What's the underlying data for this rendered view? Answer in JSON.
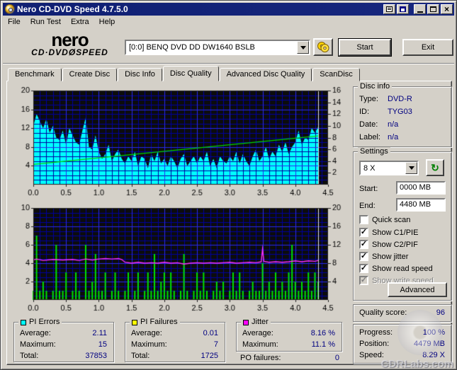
{
  "window": {
    "title": "Nero CD-DVD Speed 4.7.5.0"
  },
  "menu": {
    "items": [
      "File",
      "Run Test",
      "Extra",
      "Help"
    ]
  },
  "toolbar": {
    "logo_line1": "nero",
    "logo_line2": "CD·DVDØSPEED",
    "drive": "[0:0]   BENQ DVD DD DW1640 BSLB",
    "start_label": "Start",
    "exit_label": "Exit"
  },
  "tabs": {
    "items": [
      "Benchmark",
      "Create Disc",
      "Disc Info",
      "Disc Quality",
      "Advanced Disc Quality",
      "ScanDisc"
    ],
    "active": "Disc Quality"
  },
  "disc_info": {
    "title": "Disc info",
    "rows": [
      {
        "label": "Type:",
        "value": "DVD-R"
      },
      {
        "label": "ID:",
        "value": "TYG03"
      },
      {
        "label": "Date:",
        "value": "n/a"
      },
      {
        "label": "Label:",
        "value": "n/a"
      }
    ]
  },
  "settings": {
    "title": "Settings",
    "speed_value": "8 X",
    "start_label": "Start:",
    "start_value": "0000 MB",
    "end_label": "End:",
    "end_value": "4480 MB",
    "checkboxes": [
      {
        "label": "Quick scan",
        "checked": false,
        "disabled": false
      },
      {
        "label": "Show C1/PIE",
        "checked": true,
        "disabled": false
      },
      {
        "label": "Show C2/PIF",
        "checked": true,
        "disabled": false
      },
      {
        "label": "Show jitter",
        "checked": true,
        "disabled": false
      },
      {
        "label": "Show read speed",
        "checked": true,
        "disabled": false
      },
      {
        "label": "Show write speed",
        "checked": true,
        "disabled": true
      }
    ],
    "advanced_label": "Advanced"
  },
  "quality": {
    "label": "Quality score:",
    "value": "96"
  },
  "progress": {
    "rows": [
      {
        "label": "Progress:",
        "value": "100 %"
      },
      {
        "label": "Position:",
        "value": "4479 MB"
      },
      {
        "label": "Speed:",
        "value": "8.29 X"
      }
    ]
  },
  "stats": {
    "pi_errors": {
      "title": "PI Errors",
      "color": "#00ffff",
      "rows": [
        {
          "label": "Average:",
          "value": "2.11"
        },
        {
          "label": "Maximum:",
          "value": "15"
        },
        {
          "label": "Total:",
          "value": "37853"
        }
      ]
    },
    "pi_failures": {
      "title": "PI Failures",
      "color": "#ffff00",
      "rows": [
        {
          "label": "Average:",
          "value": "0.01"
        },
        {
          "label": "Maximum:",
          "value": "7"
        },
        {
          "label": "Total:",
          "value": "1725"
        }
      ]
    },
    "jitter": {
      "title": "Jitter",
      "color": "#ff00ff",
      "rows": [
        {
          "label": "Average:",
          "value": "8.16 %"
        },
        {
          "label": "Maximum:",
          "value": "11.1 %"
        }
      ]
    },
    "po_failures": {
      "label": "PO failures:",
      "value": "0"
    }
  },
  "watermark": {
    "text": "CDRLabs.com"
  },
  "chart_data": [
    {
      "type": "area",
      "title": "PI Errors scan with read speed overlay",
      "x_axis": {
        "range": [
          0,
          4.5
        ],
        "tick": 0.5,
        "minor": 0.1,
        "labels": [
          "0.0",
          "0.5",
          "1.0",
          "1.5",
          "2.0",
          "2.5",
          "3.0",
          "3.5",
          "4.0",
          "4.5"
        ]
      },
      "left_axis": {
        "range": [
          0,
          20
        ],
        "ticks": [
          4,
          8,
          12,
          16,
          20
        ],
        "minor": 1
      },
      "right_axis": {
        "range": [
          0,
          16
        ],
        "ticks": [
          2,
          4,
          6,
          8,
          10,
          12,
          14,
          16
        ]
      },
      "plot_bg": "#0c0c0c",
      "grid_minor": "#0000a0",
      "grid_major": "#2828f0",
      "end_marker_x": 4.35,
      "end_marker_color": "#e0e0e0",
      "series": [
        {
          "name": "PI Errors",
          "style": "area",
          "axis": "left",
          "color": "#00ffff",
          "x_step": 0.05,
          "values": [
            12.5,
            15,
            13.5,
            12,
            14,
            11,
            12.5,
            10,
            9.5,
            11.5,
            8.5,
            12,
            10.5,
            9,
            8.5,
            11.5,
            14.2,
            8,
            7.5,
            10.5,
            7,
            5.5,
            6.5,
            8.5,
            5,
            6.5,
            7.5,
            5.5,
            4.5,
            6,
            5,
            7,
            4,
            6,
            5.5,
            3.5,
            6.5,
            5,
            7,
            4.5,
            5.5,
            4,
            6,
            5,
            3.5,
            5.5,
            6.5,
            4,
            5,
            6,
            4.5,
            6,
            5,
            7,
            4,
            5.5,
            3.5,
            6,
            5,
            4.5,
            6,
            5,
            7,
            4.5,
            6.5,
            5,
            4,
            6,
            7.5,
            5,
            6,
            8,
            5.5,
            7,
            6,
            8.5,
            7,
            9,
            6.5,
            8,
            9,
            11.5,
            8.5,
            10,
            9.5,
            12,
            11,
            12.3
          ]
        },
        {
          "name": "Read speed",
          "style": "line",
          "axis": "right",
          "color": "#00d800",
          "points": [
            [
              0,
              3.45
            ],
            [
              4.35,
              8.29
            ]
          ]
        }
      ]
    },
    {
      "type": "bar",
      "title": "PI Failures scan with jitter overlay",
      "x_axis": {
        "range": [
          0,
          4.5
        ],
        "tick": 0.5,
        "minor": 0.1,
        "labels": [
          "0.0",
          "0.5",
          "1.0",
          "1.5",
          "2.0",
          "2.5",
          "3.0",
          "3.5",
          "4.0",
          "4.5"
        ]
      },
      "left_axis": {
        "range": [
          0,
          10
        ],
        "ticks": [
          2,
          4,
          6,
          8,
          10
        ],
        "minor": 0.5
      },
      "right_axis": {
        "range": [
          0,
          20
        ],
        "ticks": [
          4,
          8,
          12,
          16,
          20
        ]
      },
      "plot_bg": "#0c0c0c",
      "grid_minor": "#0000a0",
      "grid_major": "#2828f0",
      "end_marker_x": 4.35,
      "end_marker_color": "#e0e0e0",
      "series": [
        {
          "name": "PI Failures",
          "style": "bars",
          "axis": "left",
          "color": "#00e400",
          "x_step": 0.05,
          "values": [
            1,
            7,
            1,
            2,
            1,
            0,
            1,
            6,
            1,
            1,
            3,
            0,
            1,
            3,
            1,
            0,
            6,
            1,
            2,
            5,
            1,
            1,
            3,
            0,
            1,
            3,
            1,
            0,
            1,
            3,
            0,
            1,
            3,
            0,
            1,
            3,
            1,
            5,
            1,
            2,
            3,
            1,
            3,
            1,
            0,
            1,
            5,
            1,
            0,
            1,
            3,
            1,
            3,
            1,
            0,
            1,
            2,
            1,
            2,
            0,
            1,
            3,
            1,
            3,
            1,
            0,
            1,
            2,
            1,
            1,
            4,
            1,
            2,
            1,
            3,
            1,
            2,
            1,
            3,
            6,
            2,
            1,
            2,
            1,
            3,
            1,
            3,
            2
          ]
        },
        {
          "name": "Jitter",
          "style": "line",
          "axis": "right",
          "color": "#ff30ff",
          "points": [
            [
              0,
              8.7
            ],
            [
              0.05,
              8.9
            ],
            [
              0.15,
              8.6
            ],
            [
              0.3,
              8.8
            ],
            [
              0.45,
              8.7
            ],
            [
              0.6,
              8.8
            ],
            [
              0.7,
              8.6
            ],
            [
              0.8,
              8.9
            ],
            [
              0.9,
              8.7
            ],
            [
              1.0,
              8.9
            ],
            [
              1.1,
              9.0
            ],
            [
              1.2,
              8.9
            ],
            [
              1.3,
              9.0
            ],
            [
              1.35,
              8.8
            ],
            [
              1.4,
              8.2
            ],
            [
              1.5,
              8.0
            ],
            [
              1.6,
              8.2
            ],
            [
              1.7,
              8.0
            ],
            [
              1.8,
              8.1
            ],
            [
              1.9,
              8.0
            ],
            [
              2.0,
              8.2
            ],
            [
              2.1,
              8.0
            ],
            [
              2.2,
              8.1
            ],
            [
              2.3,
              7.8
            ],
            [
              2.4,
              8.0
            ],
            [
              2.5,
              8.1
            ],
            [
              2.6,
              8.0
            ],
            [
              2.7,
              8.1
            ],
            [
              2.8,
              8.0
            ],
            [
              2.9,
              8.1
            ],
            [
              3.0,
              8.2
            ],
            [
              3.1,
              8.0
            ],
            [
              3.2,
              8.1
            ],
            [
              3.3,
              8.2
            ],
            [
              3.4,
              8.1
            ],
            [
              3.48,
              8.3
            ],
            [
              3.5,
              11.1
            ],
            [
              3.52,
              8.4
            ],
            [
              3.6,
              8.2
            ],
            [
              3.7,
              8.3
            ],
            [
              3.8,
              8.2
            ],
            [
              3.9,
              8.3
            ],
            [
              4.0,
              8.5
            ],
            [
              4.1,
              8.3
            ],
            [
              4.2,
              8.5
            ],
            [
              4.3,
              8.4
            ],
            [
              4.35,
              8.6
            ]
          ]
        }
      ]
    }
  ]
}
